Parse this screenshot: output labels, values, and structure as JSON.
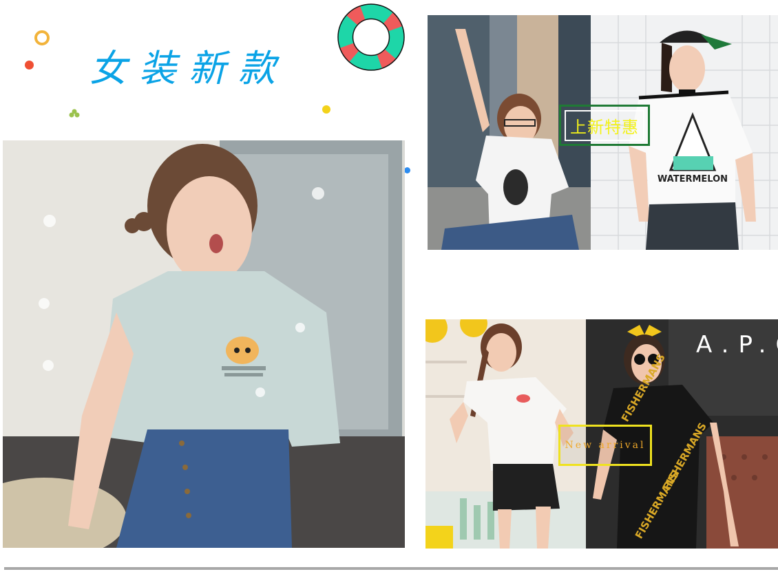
{
  "title": "女装新款",
  "badge_cn": "上新特惠",
  "badge_en": "New arrival",
  "photos": {
    "main": "main-model-photo",
    "top_left": "model-peace-sign-photo",
    "top_right": "model-cap-watermelon-tee-photo",
    "bottom_left": "model-white-tee-photo",
    "bottom_right": "model-black-print-tee-photo"
  },
  "photo_texts": {
    "watermelon_tee": "WATERMELON",
    "shirt_print": "FISHERMANS",
    "wall_sign": "A.P.C"
  },
  "colors": {
    "title": "#0aa3e6",
    "badge_cn_border": "#1f7a35",
    "badge_cn_text": "#f3f21a",
    "badge_en_border": "#efe21f",
    "badge_en_text": "#f0a92a",
    "lifebuoy_red": "#ef5b5b",
    "lifebuoy_green": "#1ed6a8",
    "divider": "#a8a8a8"
  }
}
